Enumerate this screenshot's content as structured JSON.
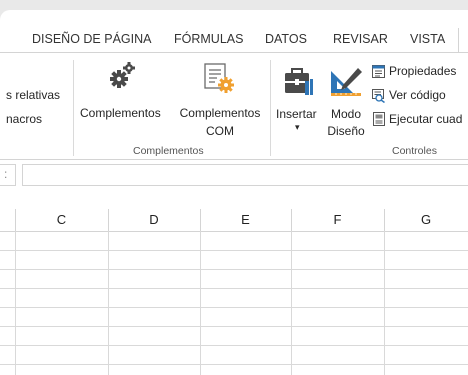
{
  "tabs": [
    {
      "label": "DISEÑO DE PÁGINA"
    },
    {
      "label": "FÓRMULAS"
    },
    {
      "label": "DATOS"
    },
    {
      "label": "REVISAR"
    },
    {
      "label": "VISTA"
    }
  ],
  "ribbon": {
    "left_cut": {
      "line1": "s relativas",
      "line2": "nacros"
    },
    "complementos": {
      "btn1": "Complementos",
      "btn2_line1": "Complementos",
      "btn2_line2": "COM",
      "group_label": "Complementos"
    },
    "controles": {
      "insertar": "Insertar",
      "insertar_arrow": "▾",
      "modo_line1": "Modo",
      "modo_line2": "Diseño",
      "propiedades": "Propiedades",
      "ver_codigo": "Ver código",
      "ejecutar": "Ejecutar cuad",
      "group_label": "Controles"
    }
  },
  "formula_bar": {
    "namebox_tail": ":"
  },
  "columns": [
    "C",
    "D",
    "E",
    "F",
    "G"
  ],
  "colors": {
    "accent": "#217346",
    "icon_orange": "#f0a030",
    "icon_gray": "#4a4a4a",
    "icon_blue": "#2e75b6"
  }
}
